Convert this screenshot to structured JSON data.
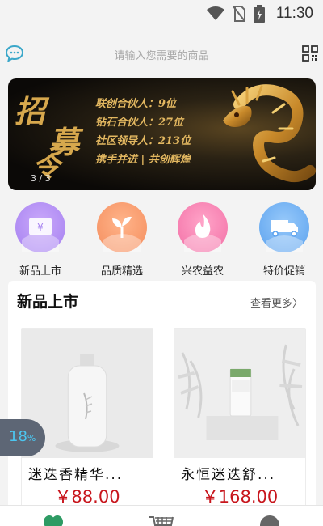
{
  "status_bar": {
    "time": "11:30"
  },
  "search": {
    "placeholder": "请输入您需要的商品"
  },
  "banner": {
    "big_chars": [
      "招",
      "募",
      "令"
    ],
    "lines": [
      "联创合伙人：9位",
      "钻石合伙人：27位",
      "社区领导人：213位",
      "携手并进 | 共创辉煌"
    ],
    "pager": "3 / 3"
  },
  "categories": [
    {
      "label": "新品上市",
      "icon": "ticket-icon",
      "color": "#b58ef3"
    },
    {
      "label": "品质精选",
      "icon": "sprout-icon",
      "color": "#f59a6d"
    },
    {
      "label": "兴农益农",
      "icon": "flame-icon",
      "color": "#f582b2"
    },
    {
      "label": "特价促销",
      "icon": "truck-icon",
      "color": "#6fb0f3"
    }
  ],
  "new_products": {
    "title": "新品上市",
    "more": "查看更多〉",
    "items": [
      {
        "name": "迷迭香精华...",
        "price": "￥88.00"
      },
      {
        "name": "永恒迷迭舒...",
        "price": "￥168.00"
      }
    ]
  },
  "progress_badge": {
    "value": "18",
    "unit": "%"
  },
  "tab_bar": {
    "icons": [
      "clover-icon",
      "cart-icon",
      "user-icon"
    ]
  }
}
